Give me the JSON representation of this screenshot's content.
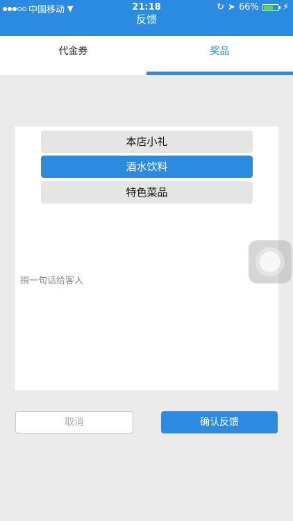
{
  "status_bar": {
    "carrier": "中国移动",
    "time": "21:18",
    "battery_percent": "66%",
    "battery_level": 0.66,
    "icons": [
      "signal-dots",
      "wifi-icon",
      "lock-rotation-icon",
      "location-icon",
      "battery-icon",
      "charging-icon"
    ]
  },
  "nav": {
    "title": "反馈"
  },
  "tabs": [
    {
      "label": "代金券",
      "active": false
    },
    {
      "label": "奖品",
      "active": true
    }
  ],
  "options": [
    {
      "label": "本店小礼",
      "selected": false
    },
    {
      "label": "酒水饮料",
      "selected": true
    },
    {
      "label": "特色菜品",
      "selected": false
    }
  ],
  "message": {
    "placeholder": "捎一句话给客人"
  },
  "buttons": {
    "cancel": "取消",
    "confirm": "确认反馈"
  },
  "colors": {
    "accent": "#2a8be1",
    "background": "#ebebeb"
  }
}
